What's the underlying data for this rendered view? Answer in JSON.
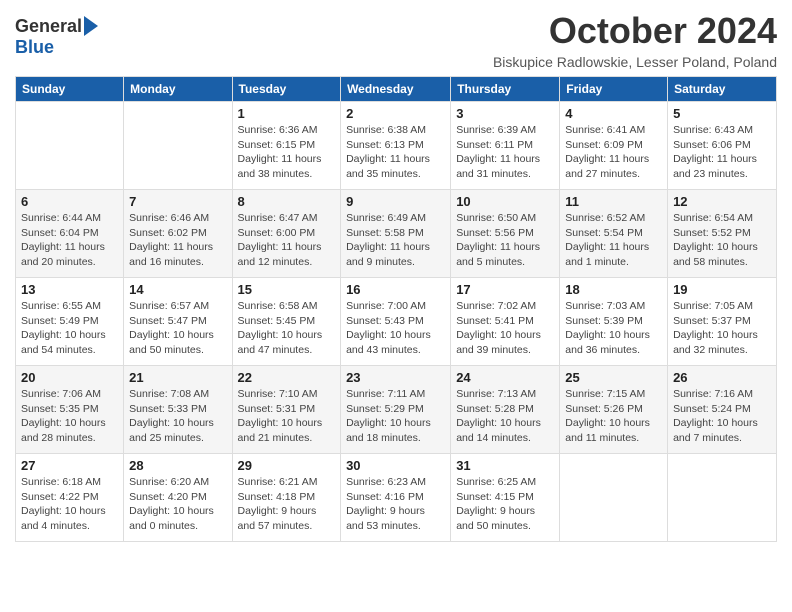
{
  "logo": {
    "general": "General",
    "blue": "Blue"
  },
  "title": "October 2024",
  "location": "Biskupice Radlowskie, Lesser Poland, Poland",
  "days_of_week": [
    "Sunday",
    "Monday",
    "Tuesday",
    "Wednesday",
    "Thursday",
    "Friday",
    "Saturday"
  ],
  "weeks": [
    [
      {
        "day": "",
        "info": ""
      },
      {
        "day": "",
        "info": ""
      },
      {
        "day": "1",
        "info": "Sunrise: 6:36 AM\nSunset: 6:15 PM\nDaylight: 11 hours and 38 minutes."
      },
      {
        "day": "2",
        "info": "Sunrise: 6:38 AM\nSunset: 6:13 PM\nDaylight: 11 hours and 35 minutes."
      },
      {
        "day": "3",
        "info": "Sunrise: 6:39 AM\nSunset: 6:11 PM\nDaylight: 11 hours and 31 minutes."
      },
      {
        "day": "4",
        "info": "Sunrise: 6:41 AM\nSunset: 6:09 PM\nDaylight: 11 hours and 27 minutes."
      },
      {
        "day": "5",
        "info": "Sunrise: 6:43 AM\nSunset: 6:06 PM\nDaylight: 11 hours and 23 minutes."
      }
    ],
    [
      {
        "day": "6",
        "info": "Sunrise: 6:44 AM\nSunset: 6:04 PM\nDaylight: 11 hours and 20 minutes."
      },
      {
        "day": "7",
        "info": "Sunrise: 6:46 AM\nSunset: 6:02 PM\nDaylight: 11 hours and 16 minutes."
      },
      {
        "day": "8",
        "info": "Sunrise: 6:47 AM\nSunset: 6:00 PM\nDaylight: 11 hours and 12 minutes."
      },
      {
        "day": "9",
        "info": "Sunrise: 6:49 AM\nSunset: 5:58 PM\nDaylight: 11 hours and 9 minutes."
      },
      {
        "day": "10",
        "info": "Sunrise: 6:50 AM\nSunset: 5:56 PM\nDaylight: 11 hours and 5 minutes."
      },
      {
        "day": "11",
        "info": "Sunrise: 6:52 AM\nSunset: 5:54 PM\nDaylight: 11 hours and 1 minute."
      },
      {
        "day": "12",
        "info": "Sunrise: 6:54 AM\nSunset: 5:52 PM\nDaylight: 10 hours and 58 minutes."
      }
    ],
    [
      {
        "day": "13",
        "info": "Sunrise: 6:55 AM\nSunset: 5:49 PM\nDaylight: 10 hours and 54 minutes."
      },
      {
        "day": "14",
        "info": "Sunrise: 6:57 AM\nSunset: 5:47 PM\nDaylight: 10 hours and 50 minutes."
      },
      {
        "day": "15",
        "info": "Sunrise: 6:58 AM\nSunset: 5:45 PM\nDaylight: 10 hours and 47 minutes."
      },
      {
        "day": "16",
        "info": "Sunrise: 7:00 AM\nSunset: 5:43 PM\nDaylight: 10 hours and 43 minutes."
      },
      {
        "day": "17",
        "info": "Sunrise: 7:02 AM\nSunset: 5:41 PM\nDaylight: 10 hours and 39 minutes."
      },
      {
        "day": "18",
        "info": "Sunrise: 7:03 AM\nSunset: 5:39 PM\nDaylight: 10 hours and 36 minutes."
      },
      {
        "day": "19",
        "info": "Sunrise: 7:05 AM\nSunset: 5:37 PM\nDaylight: 10 hours and 32 minutes."
      }
    ],
    [
      {
        "day": "20",
        "info": "Sunrise: 7:06 AM\nSunset: 5:35 PM\nDaylight: 10 hours and 28 minutes."
      },
      {
        "day": "21",
        "info": "Sunrise: 7:08 AM\nSunset: 5:33 PM\nDaylight: 10 hours and 25 minutes."
      },
      {
        "day": "22",
        "info": "Sunrise: 7:10 AM\nSunset: 5:31 PM\nDaylight: 10 hours and 21 minutes."
      },
      {
        "day": "23",
        "info": "Sunrise: 7:11 AM\nSunset: 5:29 PM\nDaylight: 10 hours and 18 minutes."
      },
      {
        "day": "24",
        "info": "Sunrise: 7:13 AM\nSunset: 5:28 PM\nDaylight: 10 hours and 14 minutes."
      },
      {
        "day": "25",
        "info": "Sunrise: 7:15 AM\nSunset: 5:26 PM\nDaylight: 10 hours and 11 minutes."
      },
      {
        "day": "26",
        "info": "Sunrise: 7:16 AM\nSunset: 5:24 PM\nDaylight: 10 hours and 7 minutes."
      }
    ],
    [
      {
        "day": "27",
        "info": "Sunrise: 6:18 AM\nSunset: 4:22 PM\nDaylight: 10 hours and 4 minutes."
      },
      {
        "day": "28",
        "info": "Sunrise: 6:20 AM\nSunset: 4:20 PM\nDaylight: 10 hours and 0 minutes."
      },
      {
        "day": "29",
        "info": "Sunrise: 6:21 AM\nSunset: 4:18 PM\nDaylight: 9 hours and 57 minutes."
      },
      {
        "day": "30",
        "info": "Sunrise: 6:23 AM\nSunset: 4:16 PM\nDaylight: 9 hours and 53 minutes."
      },
      {
        "day": "31",
        "info": "Sunrise: 6:25 AM\nSunset: 4:15 PM\nDaylight: 9 hours and 50 minutes."
      },
      {
        "day": "",
        "info": ""
      },
      {
        "day": "",
        "info": ""
      }
    ]
  ]
}
